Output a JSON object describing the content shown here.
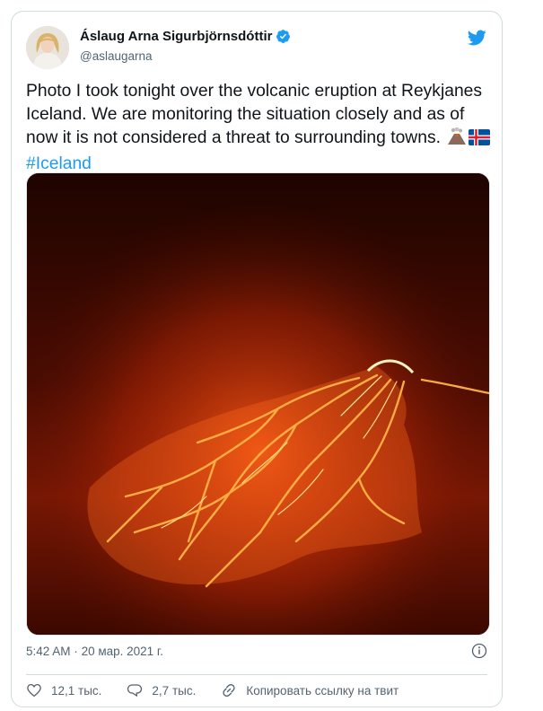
{
  "author": {
    "display_name": "Áslaug Arna Sigurbjörnsdóttir",
    "handle": "@aslaugarna",
    "verified": true
  },
  "tweet": {
    "text": "Photo I took tonight over the volcanic eruption at Reykjanes Iceland. We are monitoring the situation closely and as of now it is not considered a threat to surrounding towns.",
    "emojis": [
      "volcano-emoji",
      "iceland-flag-emoji"
    ],
    "hashtag": "#Iceland",
    "photo": "volcanic-eruption-lava-photo"
  },
  "meta": {
    "time": "5:42 AM",
    "separator": "·",
    "date": "20 мар. 2021 г."
  },
  "actions": {
    "likes": "12,1 тыс.",
    "replies": "2,7 тыс.",
    "copy_link": "Копировать ссылку на твит"
  },
  "colors": {
    "accent": "#1d9bf0",
    "text": "#0f1419",
    "secondary": "#536471",
    "border": "#cfd9de"
  }
}
